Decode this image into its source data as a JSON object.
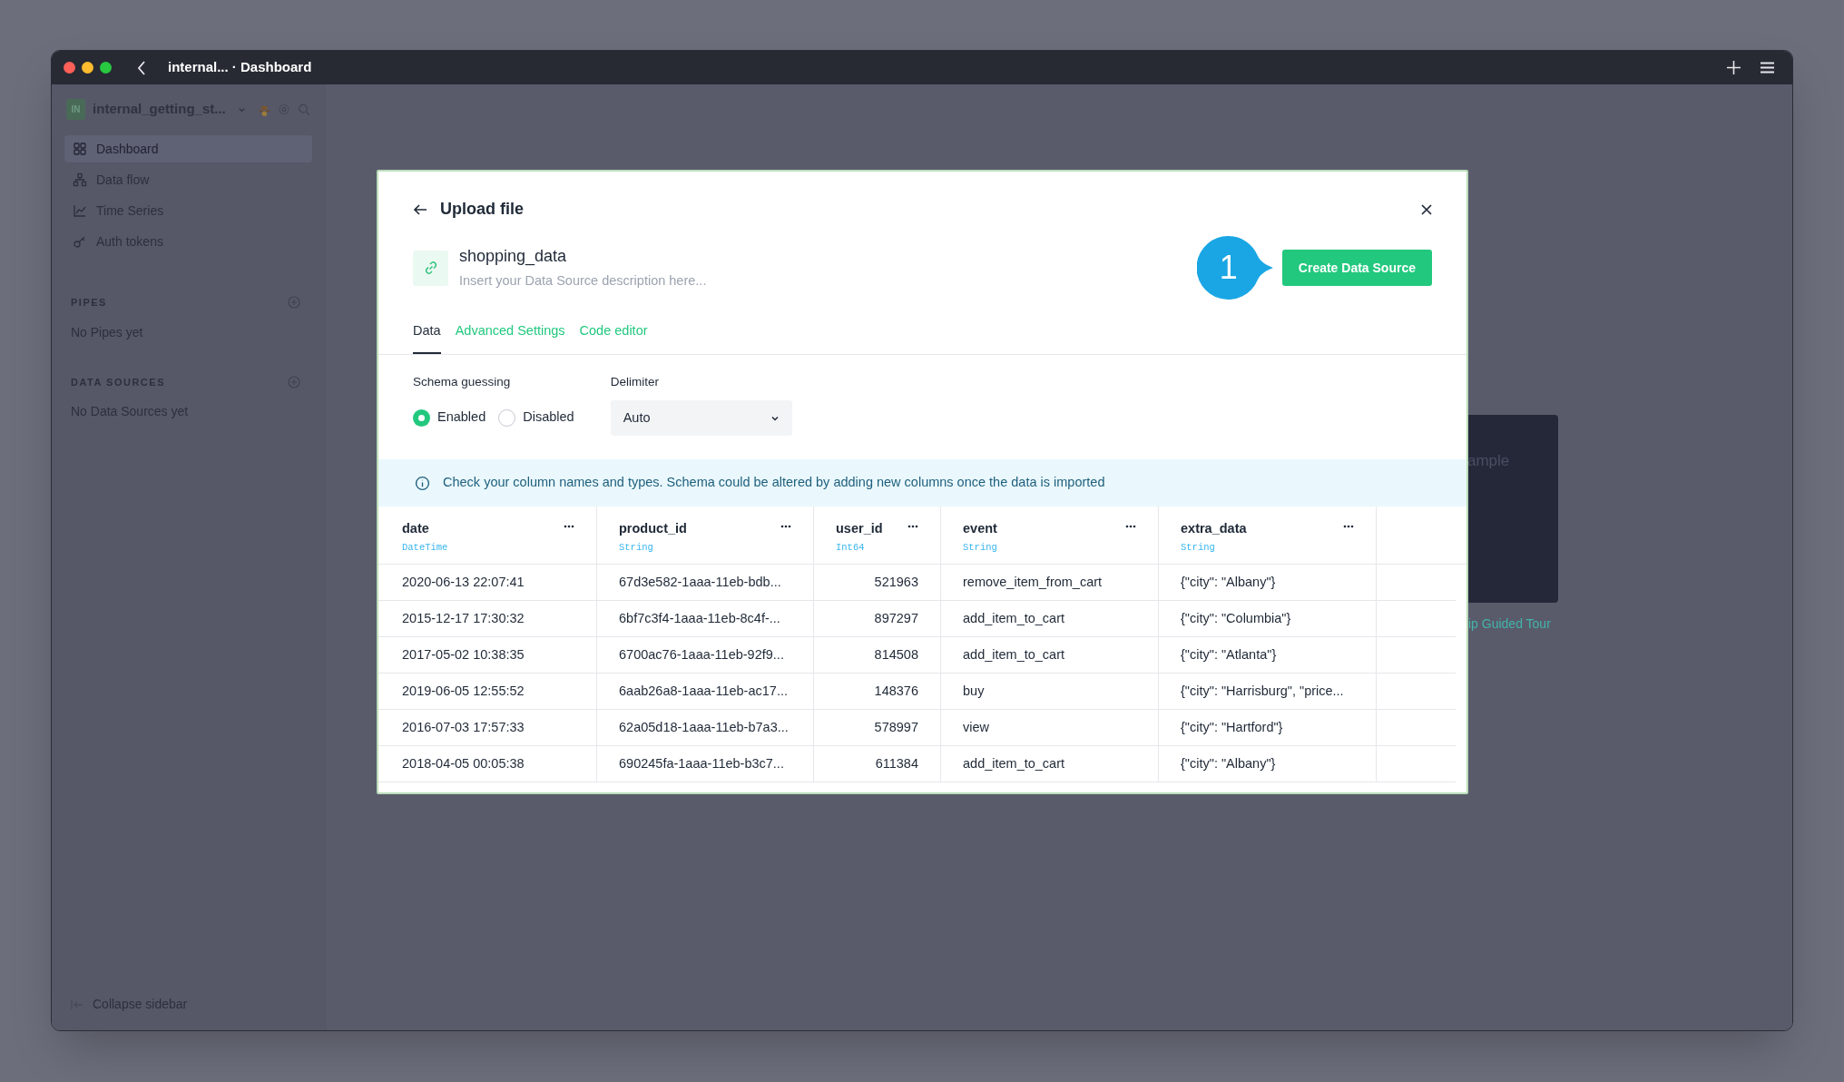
{
  "window": {
    "title": "internal... · Dashboard"
  },
  "sidebar": {
    "workspace": {
      "initials": "IN",
      "name": "internal_getting_st..."
    },
    "nav": [
      {
        "label": "Dashboard",
        "kind": "grid",
        "selected": true
      },
      {
        "label": "Data flow",
        "kind": "flow",
        "selected": false
      },
      {
        "label": "Time Series",
        "kind": "chart",
        "selected": false
      },
      {
        "label": "Auth tokens",
        "kind": "key",
        "selected": false
      }
    ],
    "sections": [
      {
        "title": "PIPES",
        "empty": "No Pipes yet"
      },
      {
        "title": "DATA SOURCES",
        "empty": "No Data Sources yet"
      }
    ],
    "collapse": "Collapse sidebar"
  },
  "background": {
    "card_text": "ample",
    "link": "ip Guided Tour"
  },
  "modal": {
    "title": "Upload file",
    "name": "shopping_data",
    "description_placeholder": "Insert your Data Source description here...",
    "step_badge": "1",
    "primary_button": "Create Data Source",
    "tabs": [
      {
        "label": "Data",
        "selected": true
      },
      {
        "label": "Advanced Settings",
        "selected": false
      },
      {
        "label": "Code editor",
        "selected": false
      }
    ],
    "schema_guessing": {
      "label": "Schema guessing",
      "options": [
        {
          "label": "Enabled",
          "selected": true
        },
        {
          "label": "Disabled",
          "selected": false
        }
      ]
    },
    "delimiter": {
      "label": "Delimiter",
      "value": "Auto"
    },
    "info": "Check your column names and types. Schema could be altered by adding new columns once the data is imported",
    "table": {
      "columns": [
        {
          "name": "date",
          "type": "DateTime",
          "numeric": false
        },
        {
          "name": "product_id",
          "type": "String",
          "numeric": false
        },
        {
          "name": "user_id",
          "type": "Int64",
          "numeric": true
        },
        {
          "name": "event",
          "type": "String",
          "numeric": false
        },
        {
          "name": "extra_data",
          "type": "String",
          "numeric": false
        }
      ],
      "rows": [
        [
          "2020-06-13 22:07:41",
          "67d3e582-1aaa-11eb-bdb...",
          "521963",
          "remove_item_from_cart",
          "{\"city\": \"Albany\"}"
        ],
        [
          "2015-12-17 17:30:32",
          "6bf7c3f4-1aaa-11eb-8c4f-...",
          "897297",
          "add_item_to_cart",
          "{\"city\": \"Columbia\"}"
        ],
        [
          "2017-05-02 10:38:35",
          "6700ac76-1aaa-11eb-92f9...",
          "814508",
          "add_item_to_cart",
          "{\"city\": \"Atlanta\"}"
        ],
        [
          "2019-06-05 12:55:52",
          "6aab26a8-1aaa-11eb-ac17...",
          "148376",
          "buy",
          "{\"city\": \"Harrisburg\", \"price..."
        ],
        [
          "2016-07-03 17:57:33",
          "62a05d18-1aaa-11eb-b7a3...",
          "578997",
          "view",
          "{\"city\": \"Hartford\"}"
        ],
        [
          "2018-04-05 00:05:38",
          "690245fa-1aaa-11eb-b3c7...",
          "611384",
          "add_item_to_cart",
          "{\"city\": \"Albany\"}"
        ]
      ]
    }
  }
}
